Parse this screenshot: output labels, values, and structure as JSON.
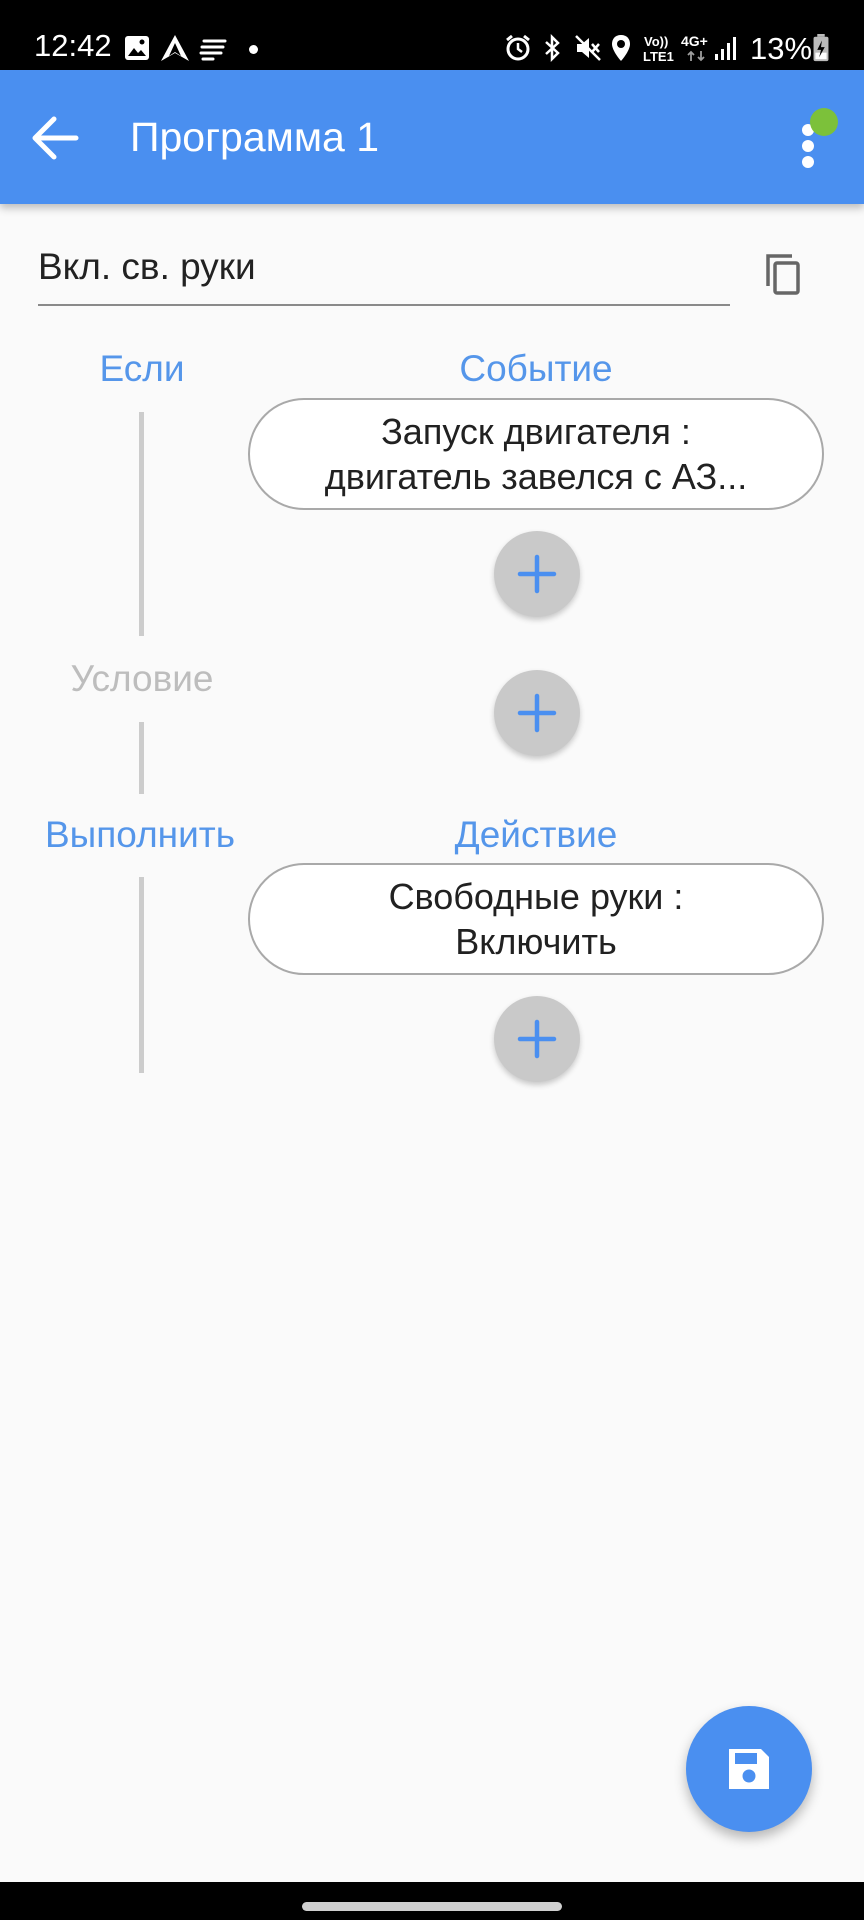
{
  "status_bar": {
    "time": "12:42",
    "network_label_top": "Vo))",
    "network_label_bottom": "LTE1",
    "network_type": "4G+",
    "battery": "13%",
    "icons": [
      "gallery-icon",
      "navigation-app-icon",
      "notes-icon",
      "notification-dot-icon",
      "alarm-icon",
      "bluetooth-icon",
      "mute-icon",
      "location-icon",
      "signal-icon",
      "battery-charging-icon"
    ]
  },
  "app_bar": {
    "title": "Программа 1",
    "back_icon": "arrow-back-icon",
    "menu_icon": "more-vert-icon",
    "status_color": "#7cc13a"
  },
  "program": {
    "name_value": "Вкл. св. руки",
    "copy_icon": "copy-icon"
  },
  "rule": {
    "if_label": "Если",
    "event_label": "Событие",
    "events": [
      "Запуск двигателя :\nдвигатель завелся с АЗ..."
    ],
    "condition_label": "Условие",
    "do_label": "Выполнить",
    "action_label": "Действие",
    "actions": [
      "Свободные руки :\nВключить"
    ]
  },
  "fab": {
    "icon": "save-icon"
  },
  "colors": {
    "primary": "#4a8ff0",
    "accent_text": "#5596ea",
    "muted_text": "#bdbdbd"
  }
}
